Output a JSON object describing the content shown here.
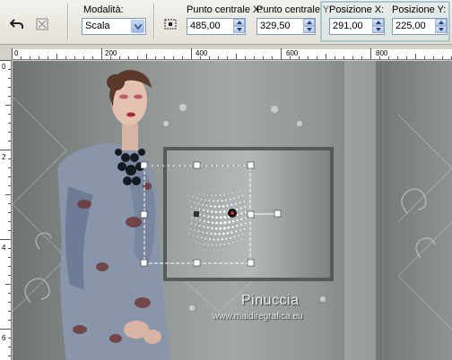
{
  "toolbar": {
    "mode_label": "Modalità:",
    "mode_value": "Scala",
    "center_x_label": "Punto centrale X:",
    "center_x_value": "485,00",
    "center_y_label": "Punto centrale Y:",
    "center_y_value": "329,50",
    "pos_x_label": "Posizione X:",
    "pos_x_value": "291,00",
    "pos_y_label": "Posizione Y:",
    "pos_y_value": "225,00"
  },
  "ruler": {
    "h_labels": [
      "0",
      "200",
      "400",
      "600",
      "800"
    ],
    "v_labels": [
      "0",
      "2",
      "4",
      "6"
    ]
  },
  "canvas": {
    "watermark_title": "Pinuccia",
    "watermark_url": "www.maidiregrafica.eu"
  },
  "icons": {
    "reset": "undo-arrow-icon",
    "scale_tool": "scale-tool-icon",
    "center": "center-point-icon"
  },
  "colors": {
    "highlight_border": "#a9c8ce",
    "combo_border": "#7f9db9"
  }
}
